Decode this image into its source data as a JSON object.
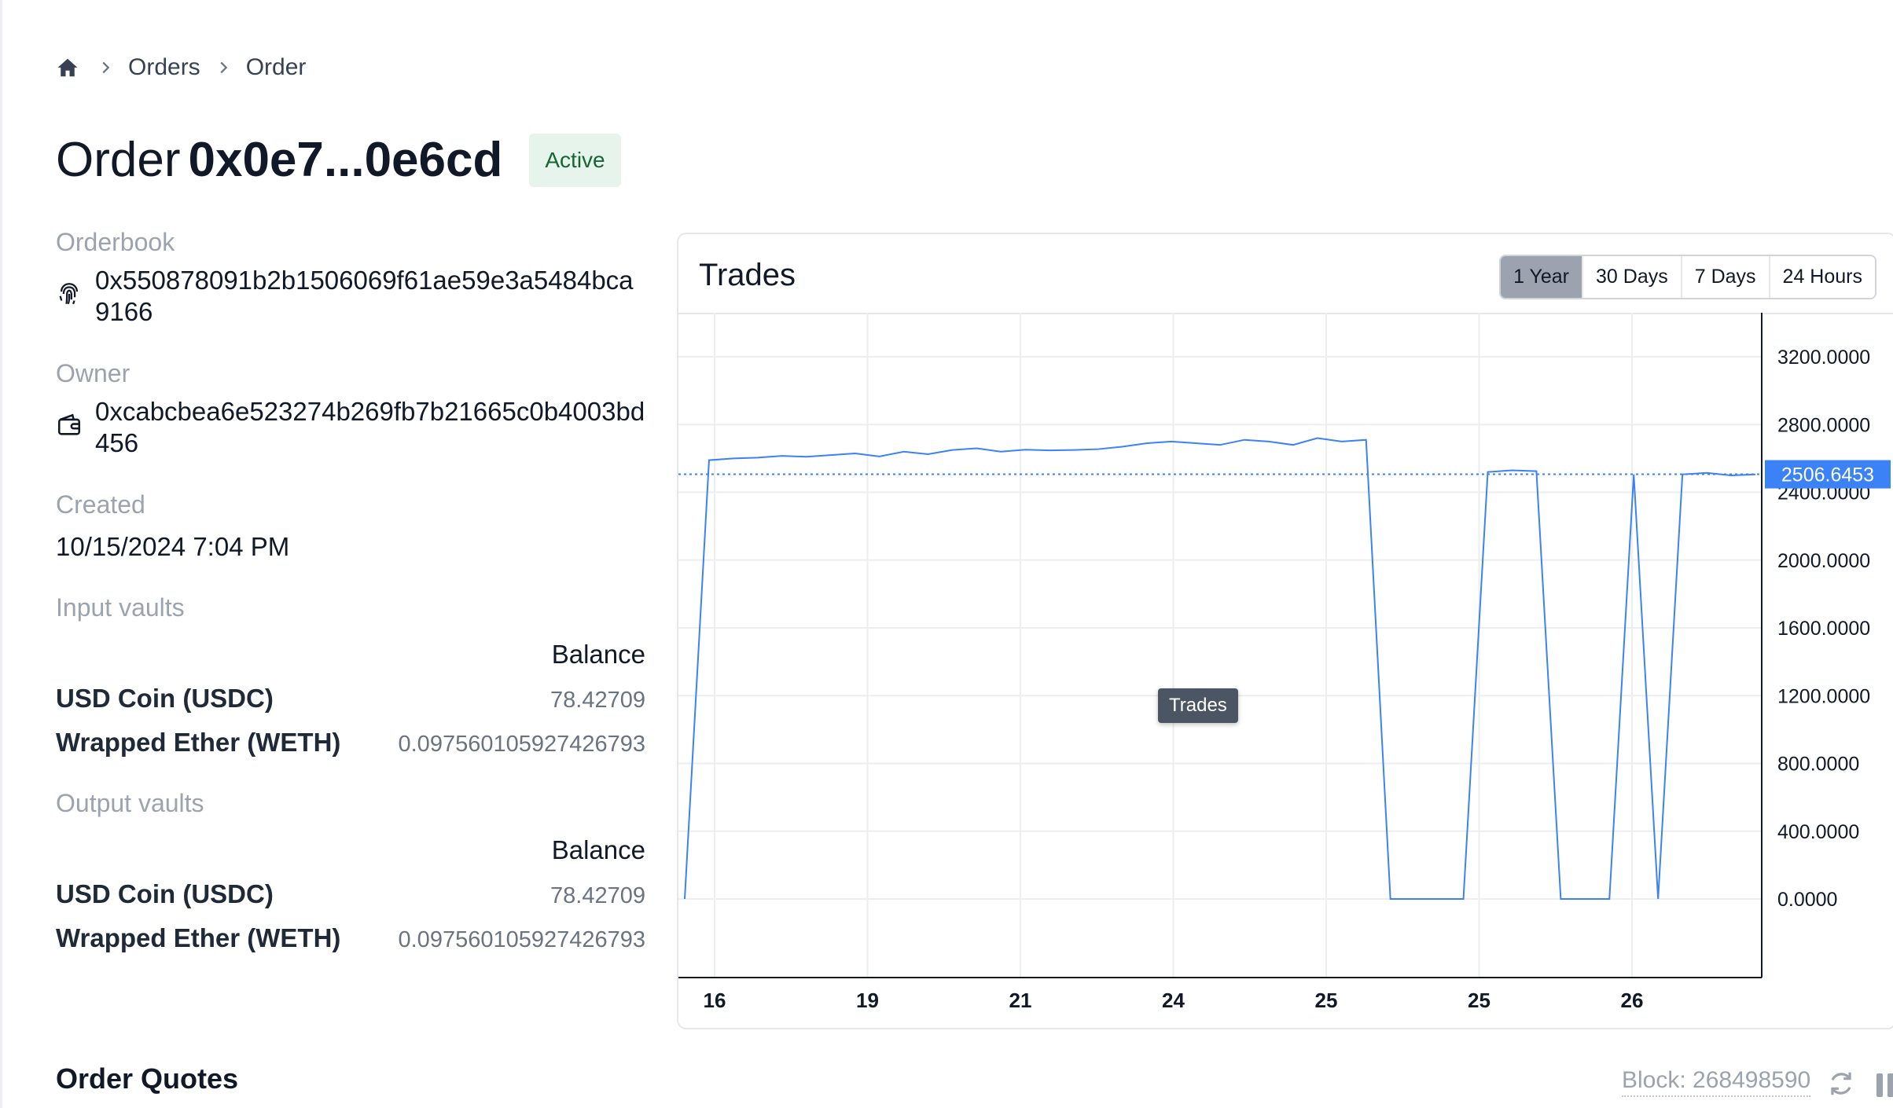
{
  "breadcrumb": {
    "items": [
      "Orders",
      "Order"
    ]
  },
  "order": {
    "prefix": "Order",
    "hash": "0x0e7...0e6cd",
    "status": "Active"
  },
  "details": {
    "orderbook_label": "Orderbook",
    "orderbook_address": "0x550878091b2b1506069f61ae59e3a5484bca9166",
    "owner_label": "Owner",
    "owner_address": "0xcabcbea6e523274b269fb7b21665c0b4003bd456",
    "created_label": "Created",
    "created_value": "10/15/2024 7:04 PM"
  },
  "input_vaults": {
    "label": "Input vaults",
    "balance_header": "Balance",
    "rows": [
      {
        "name": "USD Coin (USDC)",
        "balance": "78.42709"
      },
      {
        "name": "Wrapped Ether (WETH)",
        "balance": "0.097560105927426793"
      }
    ]
  },
  "output_vaults": {
    "label": "Output vaults",
    "balance_header": "Balance",
    "rows": [
      {
        "name": "USD Coin (USDC)",
        "balance": "78.42709"
      },
      {
        "name": "Wrapped Ether (WETH)",
        "balance": "0.097560105927426793"
      }
    ]
  },
  "trades": {
    "title": "Trades",
    "ranges": [
      "1 Year",
      "30 Days",
      "7 Days",
      "24 Hours"
    ],
    "selected_range": "1 Year",
    "tooltip": "Trades",
    "current_price_label": "2506.6453"
  },
  "chart_data": {
    "type": "line",
    "title": "Trades",
    "y_ticks": [
      "0.0000",
      "400.0000",
      "800.0000",
      "1200.0000",
      "1600.0000",
      "2000.0000",
      "2400.0000",
      "2800.0000",
      "3200.0000"
    ],
    "x_tick_labels": [
      "16",
      "19",
      "21",
      "24",
      "25",
      "25",
      "26"
    ],
    "ylim": [
      0,
      3460
    ],
    "current_value": 2506.6453,
    "grid": true,
    "y_axis_side": "right",
    "line_color": "#3b82f6",
    "series": [
      {
        "values": [
          0,
          2590,
          2600,
          2605,
          2615,
          2610,
          2620,
          2630,
          2612,
          2640,
          2625,
          2650,
          2660,
          2640,
          2652,
          2648,
          2650,
          2655,
          2670,
          2690,
          2700,
          2690,
          2680,
          2710,
          2700,
          2680,
          2720,
          2700,
          2710,
          0,
          0,
          0,
          0,
          2520,
          2530,
          2525,
          0,
          0,
          0,
          2506,
          0,
          2506,
          2515,
          2500,
          2506
        ]
      }
    ]
  },
  "footer": {
    "quotes_title": "Order Quotes",
    "block_text": "Block: 268498590"
  }
}
